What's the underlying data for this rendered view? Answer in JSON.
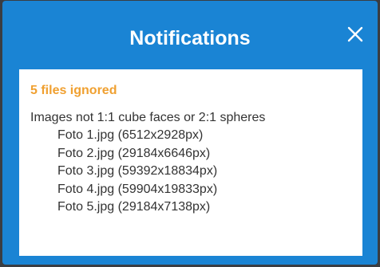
{
  "dialog": {
    "title": "Notifications",
    "close_icon": "close-icon",
    "accent_color": "#1a84d4",
    "warning_color": "#f0a030"
  },
  "notice": {
    "heading": "5 files ignored",
    "message": "Images not 1:1 cube faces or 2:1 spheres",
    "files": [
      "Foto 1.jpg (6512x2928px)",
      "Foto 2.jpg (29184x6646px)",
      "Foto 3.jpg (59392x18834px)",
      "Foto 4.jpg (59904x19833px)",
      "Foto 5.jpg (29184x7138px)"
    ]
  }
}
